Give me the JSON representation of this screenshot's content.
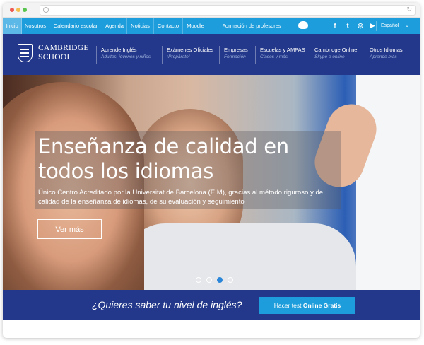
{
  "top_nav": {
    "items": [
      "Inicio",
      "Nosotros",
      "Calendario escolar",
      "Agenda",
      "Noticias",
      "Contacto",
      "Moodle",
      "Formación de profesores"
    ],
    "social": [
      "f",
      "t",
      "i",
      "yt"
    ],
    "language": "Español"
  },
  "brand": {
    "line1": "CAMBRIDGE",
    "line2": "SCHOOL"
  },
  "main_nav": [
    {
      "title": "Aprende Inglés",
      "subtitle": "Adultos, jóvenes y niños"
    },
    {
      "title": "Exámenes Oficiales",
      "subtitle": "¡Prepárate!"
    },
    {
      "title": "Empresas",
      "subtitle": "Formación"
    },
    {
      "title": "Escuelas y AMPAS",
      "subtitle": "Clases y más"
    },
    {
      "title": "Cambridge Online",
      "subtitle": "Skype o online"
    },
    {
      "title": "Otros Idiomas",
      "subtitle": "Aprende más"
    }
  ],
  "hero": {
    "headline": "Enseñanza de calidad en todos los idiomas",
    "text": "Único Centro Acreditado por la Universitat de Barcelona (EIM), gracias al método riguroso y de calidad de la enseñanza de idiomas, de su evaluación y seguimiento",
    "cta": "Ver más",
    "active_slide": 3,
    "slide_count": 4
  },
  "promo": {
    "question": "¿Quieres saber tu nivel de inglés?",
    "button_prefix": "Hacer test ",
    "button_bold": "Online Gratis"
  },
  "colors": {
    "top_nav": "#1d9ddb",
    "main_nav": "#23388a",
    "accent": "#2b86d9"
  }
}
